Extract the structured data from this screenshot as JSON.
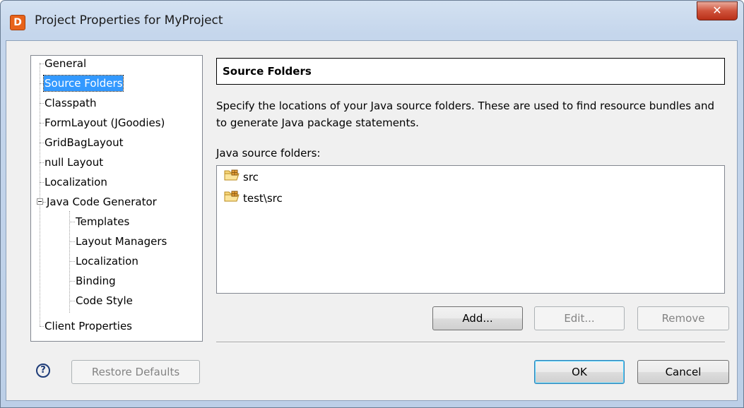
{
  "window": {
    "title": "Project Properties for MyProject",
    "app_icon_letter": "D",
    "close_glyph": "✕"
  },
  "tree": {
    "items": [
      {
        "label": "General"
      },
      {
        "label": "Source Folders",
        "selected": true
      },
      {
        "label": "Classpath"
      },
      {
        "label": "FormLayout (JGoodies)"
      },
      {
        "label": "GridBagLayout"
      },
      {
        "label": "null Layout"
      },
      {
        "label": "Localization"
      },
      {
        "label": "Java Code Generator",
        "expanded": true
      },
      {
        "label": "Templates"
      },
      {
        "label": "Layout Managers"
      },
      {
        "label": "Localization"
      },
      {
        "label": "Binding"
      },
      {
        "label": "Code Style"
      },
      {
        "label": "Client Properties"
      }
    ]
  },
  "page": {
    "header": "Source Folders",
    "description": "Specify the locations of your Java source folders. These are used to find resource bundles and to generate Java package statements.",
    "list_label": "Java source folders:",
    "folders": [
      {
        "name": "src",
        "icon": "package-folder-icon"
      },
      {
        "name": "test\\src",
        "icon": "package-folder-icon"
      }
    ],
    "buttons": {
      "add": "Add...",
      "edit": "Edit...",
      "remove": "Remove"
    }
  },
  "footer": {
    "help_glyph": "?",
    "restore_defaults": "Restore Defaults",
    "ok": "OK",
    "cancel": "Cancel"
  },
  "colors": {
    "selection": "#3399ff",
    "title_bar": "#c5d6ec",
    "close_button": "#c8452c"
  }
}
